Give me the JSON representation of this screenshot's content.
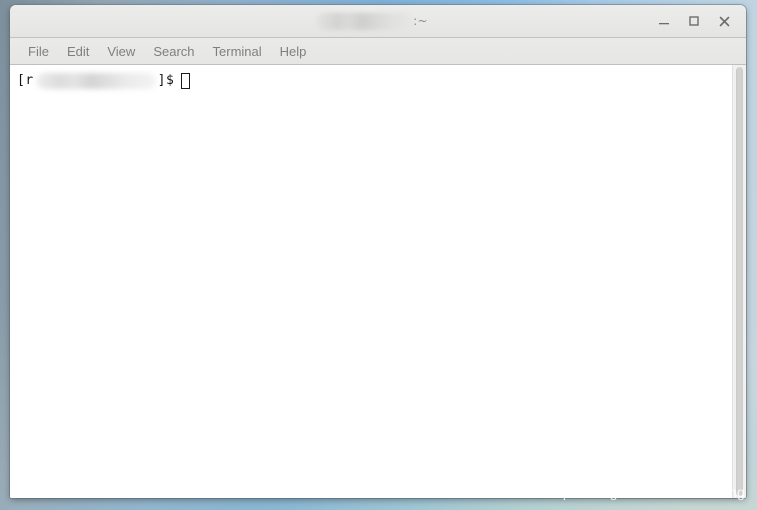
{
  "desktop": {
    "wallpaper_colors": [
      "#7d8f9c",
      "#7fb0d8",
      "#c8d6dd",
      "#e0e2b0"
    ],
    "watermark": "https://blog.csdn.net/JoshRong"
  },
  "window": {
    "title": {
      "redacted_label": "",
      "suffix": ":~"
    },
    "controls": [
      {
        "name": "minimize",
        "glyph": "–",
        "label": "Minimize"
      },
      {
        "name": "maximize",
        "glyph": "□",
        "label": "Maximize"
      },
      {
        "name": "close",
        "glyph": "✕",
        "label": "Close"
      }
    ],
    "menu": [
      {
        "label": "File"
      },
      {
        "label": "Edit"
      },
      {
        "label": "View"
      },
      {
        "label": "Search"
      },
      {
        "label": "Terminal"
      },
      {
        "label": "Help"
      }
    ],
    "terminal": {
      "prompt_prefix": "[r",
      "prompt_redacted": "",
      "prompt_suffix": "]$",
      "cursor": "block-outline",
      "background": "#ffffff",
      "foreground": "#141414",
      "command_line": "",
      "scrollbar": {
        "position": "right",
        "thumb_full": true
      }
    }
  }
}
